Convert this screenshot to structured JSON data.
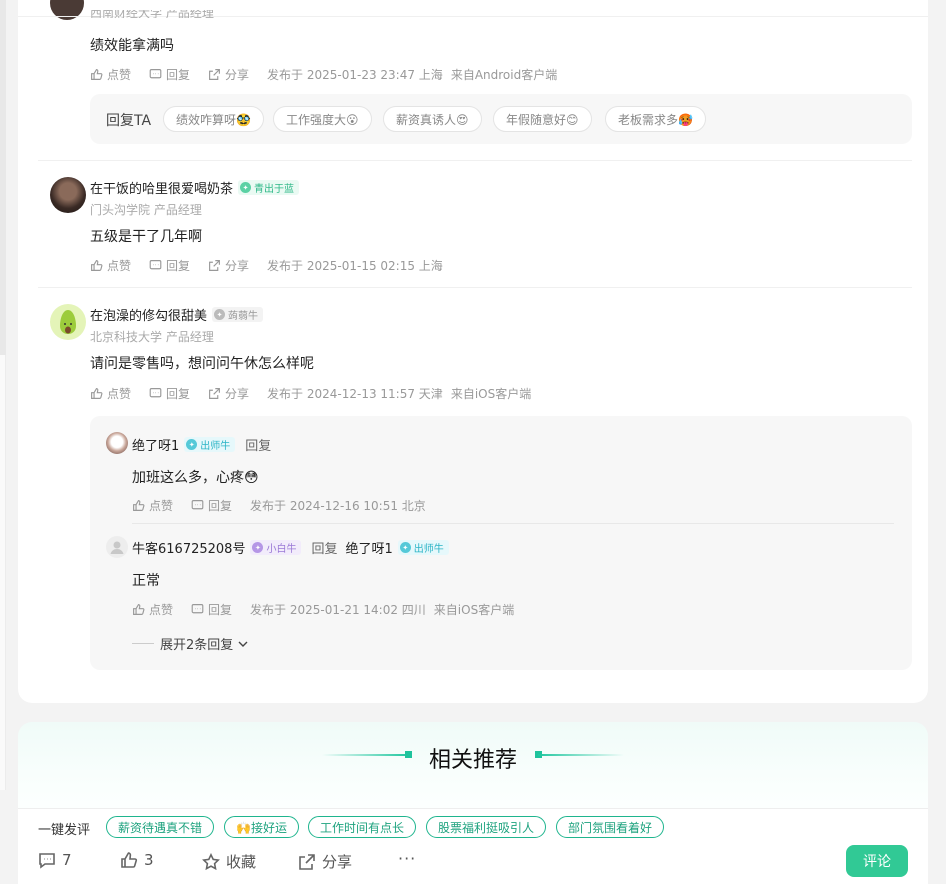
{
  "comments": [
    {
      "school": "西南财经大学 产品经理",
      "content": "绩效能拿满吗",
      "actions": {
        "like": "点赞",
        "reply": "回复",
        "share": "分享"
      },
      "time": "发布于 2025-01-23 23:47 上海",
      "client": "来自Android客户端",
      "reply_ta": {
        "label": "回复TA",
        "chips": [
          "绩效咋算呀🥸",
          "工作强度大😮",
          "薪资真诱人😍",
          "年假随意好😊",
          "老板需求多🥵"
        ]
      }
    },
    {
      "name": "在干饭的哈里很爱喝奶茶",
      "badge": "青出于蓝",
      "school": "门头沟学院 产品经理",
      "content": "五级是干了几年啊",
      "actions": {
        "like": "点赞",
        "reply": "回复",
        "share": "分享"
      },
      "time": "发布于 2025-01-15 02:15 上海"
    },
    {
      "name": "在泡澡的修勾很甜美",
      "badge": "蒟蒻牛",
      "school": "北京科技大学 产品经理",
      "content": "请问是零售吗，想问问午休怎么样呢",
      "actions": {
        "like": "点赞",
        "reply": "回复",
        "share": "分享"
      },
      "time": "发布于 2024-12-13 11:57 天津",
      "client": "来自iOS客户端",
      "replies": [
        {
          "name": "绝了呀1",
          "badge": "出师牛",
          "reply_label": "回复",
          "content": "加班这么多，心疼😳",
          "like": "点赞",
          "reply": "回复",
          "time": "发布于 2024-12-16 10:51 北京"
        },
        {
          "name": "牛客616725208号",
          "badge": "小白牛",
          "reply_word": "回复",
          "target": "绝了呀1",
          "target_badge": "出师牛",
          "content": "正常",
          "like": "点赞",
          "reply": "回复",
          "time": "发布于 2025-01-21 14:02 四川",
          "client": "来自iOS客户端"
        }
      ],
      "expand": "展开2条回复"
    }
  ],
  "recommend": {
    "title": "相关推荐"
  },
  "bottom_bar": {
    "quick_label": "一键发评",
    "quick_chips": [
      "薪资待遇真不错",
      "🙌接好运",
      "工作时间有点长",
      "股票福利挺吸引人",
      "部门氛围看着好"
    ],
    "comment_count": "7",
    "like_count": "3",
    "collect": "收藏",
    "share": "分享",
    "more": "···",
    "comment_button": "评论"
  },
  "colors": {
    "accent": "#31c995",
    "chip_border": "#1fb58e"
  }
}
